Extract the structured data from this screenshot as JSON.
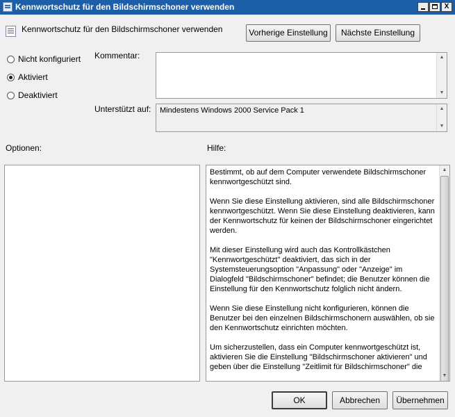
{
  "window": {
    "title": "Kennwortschutz für den Bildschirmschoner verwenden",
    "icon": "policy-setting-icon",
    "controls": {
      "minimize": "minimize-icon",
      "maximize": "maximize-icon",
      "close": "X"
    }
  },
  "header": {
    "setting_name": "Kennwortschutz für den Bildschirmschoner verwenden",
    "prev_label": "Vorherige Einstellung",
    "next_label": "Nächste Einstellung"
  },
  "state": {
    "options": [
      {
        "label": "Nicht konfiguriert",
        "selected": false
      },
      {
        "label": "Aktiviert",
        "selected": true
      },
      {
        "label": "Deaktiviert",
        "selected": false
      }
    ]
  },
  "comment": {
    "label": "Kommentar:",
    "value": ""
  },
  "supported": {
    "label": "Unterstützt auf:",
    "value": "Mindestens Windows 2000 Service Pack 1"
  },
  "options_panel": {
    "label": "Optionen:"
  },
  "help_panel": {
    "label": "Hilfe:",
    "paragraphs": [
      "Bestimmt, ob auf dem Computer verwendete Bildschirmschoner kennwortgeschützt sind.",
      "Wenn Sie diese Einstellung aktivieren, sind alle Bildschirmschoner kennwortgeschützt. Wenn Sie diese Einstellung deaktivieren, kann der Kennwortschutz für keinen der Bildschirmschoner eingerichtet werden.",
      "Mit dieser Einstellung wird auch das Kontrollkästchen \"Kennwortgeschützt\" deaktiviert, das sich in der Systemsteuerungsoption \"Anpassung\" oder \"Anzeige\" im Dialogfeld \"Bildschirmschoner\" befindet; die Benutzer können die Einstellung für den Kennwortschutz folglich nicht ändern.",
      "Wenn Sie diese Einstellung nicht konfigurieren, können die Benutzer bei den einzelnen Bildschirmschonern auswählen, ob sie den Kennwortschutz einrichten möchten.",
      "Um sicherzustellen, dass ein Computer kennwortgeschützt ist, aktivieren Sie die Einstellung \"Bildschirmschoner aktivieren\" und geben über die Einstellung \"Zeitlimit für Bildschirmschoner\" die"
    ]
  },
  "footer": {
    "ok_label": "OK",
    "cancel_label": "Abbrechen",
    "apply_label": "Übernehmen"
  },
  "colors": {
    "titlebar": "#1c5fa8",
    "dialog_bg": "#f0f0f0",
    "field_border": "#9a9a9a"
  }
}
